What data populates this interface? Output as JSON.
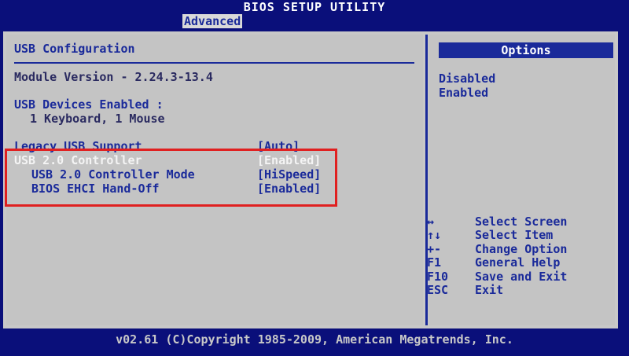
{
  "header": {
    "title": "BIOS SETUP UTILITY",
    "active_tab": "Advanced"
  },
  "left": {
    "section_title": "USB Configuration",
    "module_version": "Module Version - 2.24.3-13.4",
    "devices_label": "USB Devices Enabled :",
    "devices_value": "1 Keyboard, 1 Mouse",
    "items": [
      {
        "label": "Legacy USB Support",
        "value": "[Auto]"
      },
      {
        "label": "USB 2.0 Controller",
        "value": "[Enabled]"
      },
      {
        "label": "USB 2.0 Controller Mode",
        "value": "[HiSpeed]"
      },
      {
        "label": "BIOS EHCI Hand-Off",
        "value": "[Enabled]"
      }
    ]
  },
  "right": {
    "options_header": "Options",
    "options": [
      "Disabled",
      "Enabled"
    ],
    "help": [
      {
        "key": "↔",
        "text": "Select Screen"
      },
      {
        "key": "↑↓",
        "text": "Select Item"
      },
      {
        "key": "+-",
        "text": "Change Option"
      },
      {
        "key": "F1",
        "text": "General Help"
      },
      {
        "key": "F10",
        "text": "Save and Exit"
      },
      {
        "key": "ESC",
        "text": "Exit"
      }
    ]
  },
  "footer": {
    "copyright": "v02.61 (C)Copyright 1985-2009, American Megatrends, Inc."
  },
  "colors": {
    "background": "#0a0f7a",
    "panel": "#c4c4c4",
    "accent": "#1a2a9a",
    "highlight": "#f4f4f4",
    "annotation": "#e02020"
  }
}
